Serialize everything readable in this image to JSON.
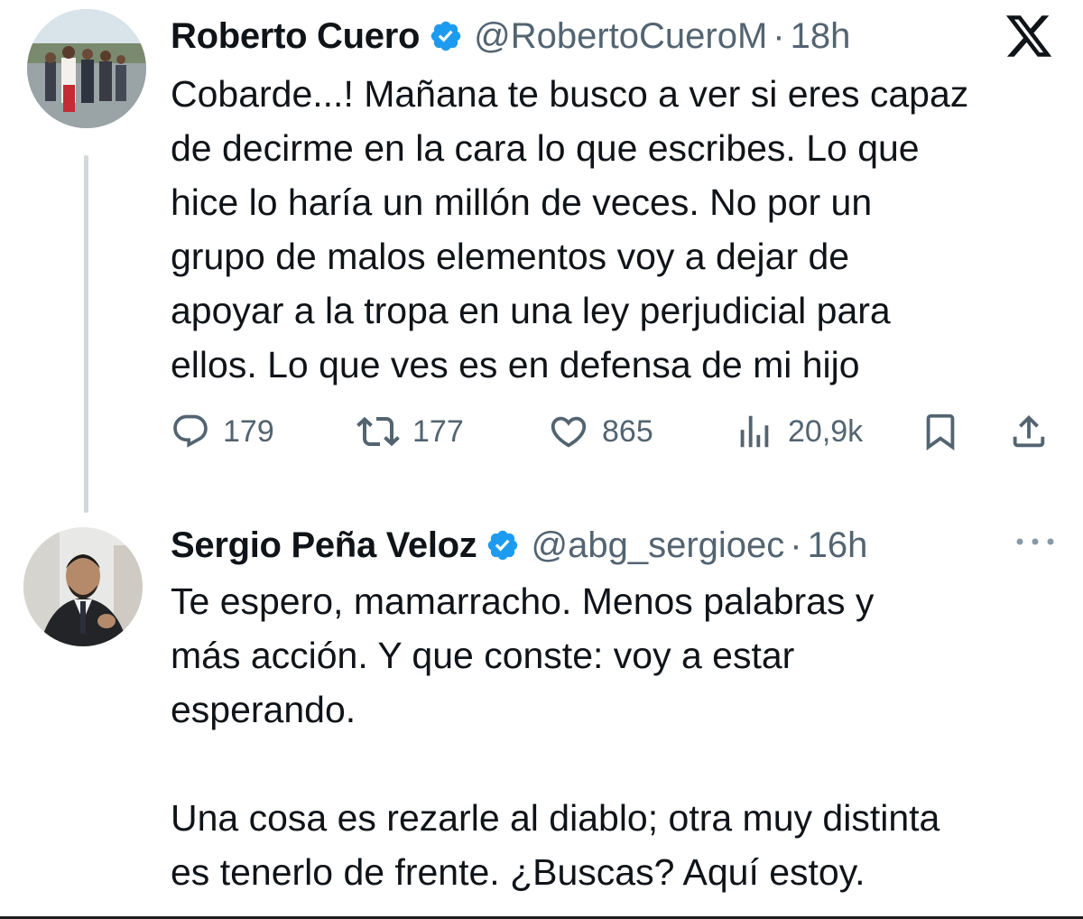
{
  "tweets": [
    {
      "author_name": "Roberto Cuero",
      "handle": "@RobertoCueroM",
      "separator": "·",
      "time": "18h",
      "text": "Cobarde...! Mañana te busco a ver si eres capaz\nde decirme en la cara lo que escribes. Lo que\nhice lo haría un millón de veces. No por un\ngrupo de malos elementos voy a dejar de\napoyar a la tropa en una ley perjudicial para\nellos. Lo que ves es en defensa de mi hijo",
      "verified": true,
      "metrics": {
        "replies": "179",
        "reposts": "177",
        "likes": "865",
        "views": "20,9k"
      }
    },
    {
      "author_name": "Sergio Peña Veloz",
      "handle": "@abg_sergioec",
      "separator": "·",
      "time": "16h",
      "text": "Te espero, mamarracho. Menos palabras y\nmás acción. Y que conste: voy a estar\nesperando.\n\nUna cosa es rezarle al diablo; otra muy distinta\nes tenerlo de frente. ¿Buscas? Aquí estoy.",
      "verified": true
    }
  ],
  "icons": {
    "brand": "x-logo-icon",
    "verified": "verified-badge-icon",
    "reply": "reply-icon",
    "repost": "repost-icon",
    "like": "heart-icon",
    "views": "views-icon",
    "bookmark": "bookmark-icon",
    "share": "share-icon",
    "more": "more-icon"
  },
  "colors": {
    "verified_blue": "#1d9bf0",
    "text_primary": "#0f1419",
    "text_secondary": "#536471",
    "thread_line": "#cfd9de"
  }
}
